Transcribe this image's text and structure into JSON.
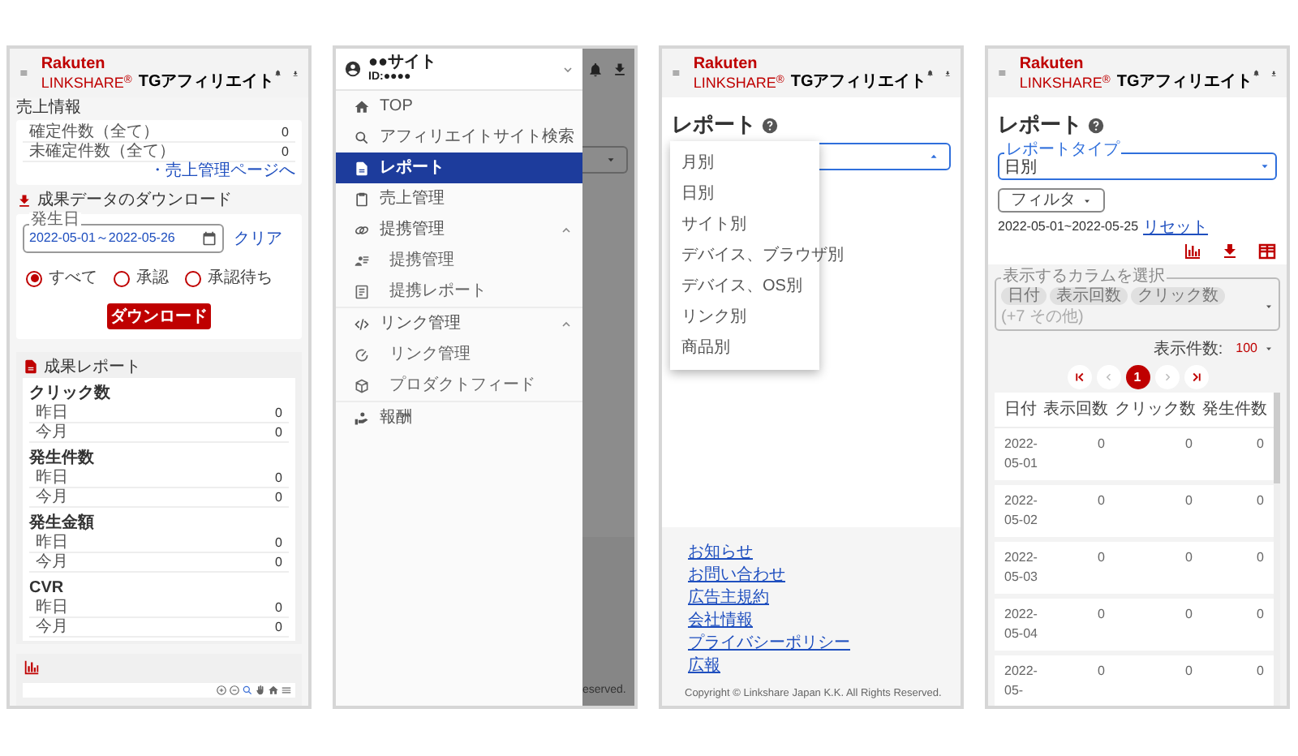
{
  "panels": [
    {
      "kind": "dashboard",
      "header": {
        "brand_top": "Rakuten",
        "brand_bottom": "LINKSHARE$^{®}$",
        "product": "TGアフィリエイト"
      },
      "sales_info": {
        "title": "売上情報",
        "rows": [
          {
            "label": "確定件数（全て）",
            "value": "0"
          },
          {
            "label": "未確定件数（全て）",
            "value": "0"
          }
        ],
        "link": "・売上管理ページへ"
      },
      "download": {
        "title": "成果データのダウンロード",
        "date_field": {
          "label": "発生日",
          "value": "2022-05-01～2022-05-26"
        },
        "clear_link": "クリア",
        "radios": [
          {
            "label": "すべて",
            "selected": true
          },
          {
            "label": "承認",
            "selected": false
          },
          {
            "label": "承認待ち",
            "selected": false
          }
        ],
        "button": "ダウンロード"
      },
      "report": {
        "title": "成果レポート",
        "metrics": [
          {
            "label": "クリック数",
            "rows": [
              {
                "label": "昨日",
                "value": "0"
              },
              {
                "label": "今月",
                "value": "0"
              }
            ]
          },
          {
            "label": "発生件数",
            "rows": [
              {
                "label": "昨日",
                "value": "0"
              },
              {
                "label": "今月",
                "value": "0"
              }
            ]
          },
          {
            "label": "発生金額",
            "rows": [
              {
                "label": "昨日",
                "value": "0"
              },
              {
                "label": "今月",
                "value": "0"
              }
            ]
          },
          {
            "label": "CVR",
            "rows": [
              {
                "label": "昨日",
                "value": "0"
              },
              {
                "label": "今月",
                "value": "0"
              }
            ]
          }
        ]
      }
    },
    {
      "kind": "menu",
      "account": {
        "name": "●●サイト",
        "id": "ID:●●●●"
      },
      "items": [
        {
          "label": "TOP",
          "selected": false
        },
        {
          "label": "アフィリエイトサイト検索",
          "selected": false
        },
        {
          "label": "レポート",
          "selected": true
        },
        {
          "label": "売上管理",
          "selected": false
        },
        {
          "label": "提携管理",
          "selected": false,
          "expanded": true,
          "children": [
            {
              "label": "提携管理",
              "selected": false
            },
            {
              "label": "提携レポート",
              "selected": false
            }
          ]
        },
        {
          "label": "リンク管理",
          "selected": false,
          "expanded": true,
          "children": [
            {
              "label": "リンク管理",
              "selected": false
            },
            {
              "label": "プロダクトフィード",
              "selected": false
            }
          ]
        },
        {
          "label": "報酬",
          "selected": false
        }
      ],
      "background": {
        "footer_fragment": "eserved."
      }
    },
    {
      "kind": "report_menu",
      "header": {
        "brand_top": "Rakuten",
        "brand_bottom": "LINKSHARE$^{®}$",
        "product": "TGアフィリエイト"
      },
      "title": "レポート",
      "select": {
        "focused": true
      },
      "options": [
        "月別",
        "日別",
        "サイト別",
        "デバイス、ブラウザ別",
        "デバイス、OS別",
        "リンク別",
        "商品別"
      ],
      "footer": {
        "links": [
          "お知らせ",
          "お問い合わせ",
          "広告主規約",
          "会社情報",
          "プライバシーポリシー",
          "広報"
        ],
        "copyright": "Copyright © Linkshare Japan K.K. All Rights Reserved."
      }
    },
    {
      "kind": "report_table",
      "header": {
        "brand_top": "Rakuten",
        "brand_bottom": "LINKSHARE$^{®}$",
        "product": "TGアフィリエイト"
      },
      "title": "レポート",
      "select": {
        "label": "レポートタイプ",
        "value": "日別",
        "focused": true
      },
      "filter_button": "フィルタ",
      "date_range": "2022-05-01~2022-05-25",
      "reset_link": "リセット",
      "column_picker": {
        "label": "表示するカラムを選択",
        "chips": [
          "日付",
          "表示回数",
          "クリック数"
        ],
        "more": "(+7 その他)"
      },
      "page_size": {
        "label": "表示件数:",
        "value": "100"
      },
      "pagination": [
        {
          "kind": "first",
          "disabled": false
        },
        {
          "kind": "prev",
          "disabled": true
        },
        {
          "kind": "page",
          "label": "1",
          "selected": true
        },
        {
          "kind": "next",
          "disabled": true
        },
        {
          "kind": "last",
          "disabled": false
        }
      ],
      "table": {
        "columns": [
          "日付",
          "表示回数",
          "クリック数",
          "発生件数"
        ],
        "rows": [
          [
            "2022-05-01",
            "0",
            "0",
            "0"
          ],
          [
            "2022-05-02",
            "0",
            "0",
            "0"
          ],
          [
            "2022-05-03",
            "0",
            "0",
            "0"
          ],
          [
            "2022-05-04",
            "0",
            "0",
            "0"
          ],
          [
            "2022-05-",
            "0",
            "0",
            "0"
          ]
        ]
      }
    }
  ]
}
